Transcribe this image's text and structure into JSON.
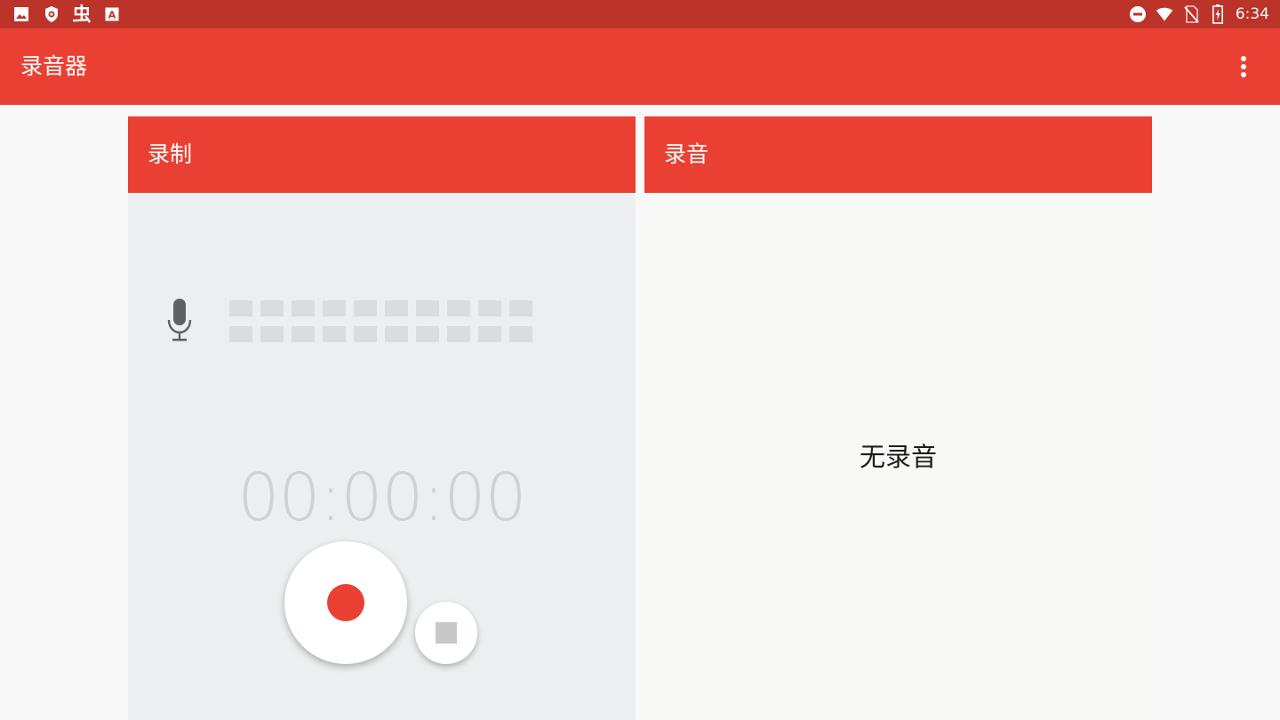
{
  "statusbar": {
    "left_icons": [
      "image-icon",
      "shield-icon",
      "bug-icon",
      "text-a-icon"
    ],
    "bug_glyph": "虫",
    "a_glyph": "A",
    "right_icons": [
      "do-not-disturb-icon",
      "wifi-icon",
      "no-sim-icon",
      "battery-charging-icon"
    ],
    "time": "6:34"
  },
  "appbar": {
    "title": "录音器",
    "menu_icon": "more-vert-icon"
  },
  "record_panel": {
    "header": "录制",
    "mic_icon": "microphone-icon",
    "level_meter": {
      "rows": 2,
      "columns": 10,
      "level": 0
    },
    "timer": "00:00:00",
    "record_button_icon": "record-icon",
    "stop_button_icon": "stop-icon"
  },
  "recordings_panel": {
    "header": "录音",
    "empty_text": "无录音"
  },
  "colors": {
    "status_bar": "#bc3329",
    "primary": "#ea4034",
    "left_card_bg": "#ebeff0",
    "right_card_bg": "#f8f8f4",
    "page_bg": "#f8f8f8",
    "timer_text": "#cfd1d2",
    "meter_bar": "#dadcdd"
  }
}
